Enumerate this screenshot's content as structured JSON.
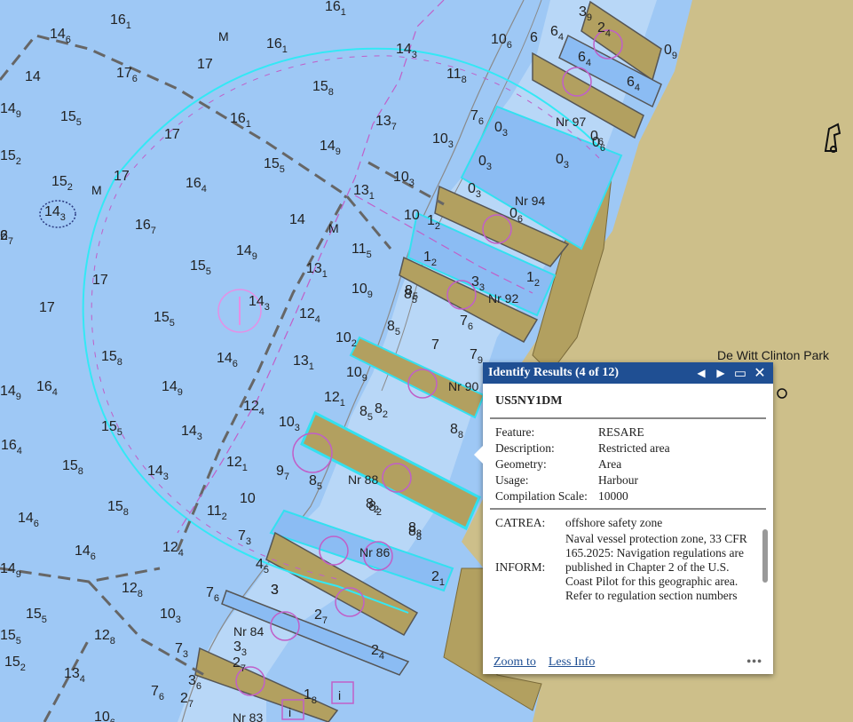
{
  "map": {
    "park_label": "De Witt Clinton Park",
    "pier_labels": [
      "Nr 97",
      "Nr 94",
      "Nr 92",
      "Nr 90",
      "Nr 88",
      "Nr 86",
      "Nr 84",
      "Nr 83"
    ],
    "mooring_symbol": "M",
    "info_symbol": "i",
    "soundings": [
      {
        "main": "14",
        "sub": "6"
      },
      {
        "main": "16",
        "sub": "1"
      },
      {
        "main": "16",
        "sub": "1"
      },
      {
        "main": "16",
        "sub": "1"
      },
      {
        "main": "14",
        "sub": "3"
      },
      {
        "main": "10",
        "sub": "6"
      },
      {
        "main": "14",
        "sub": ""
      },
      {
        "main": "17",
        "sub": "6"
      },
      {
        "main": "17",
        "sub": ""
      },
      {
        "main": "15",
        "sub": "8"
      },
      {
        "main": "11",
        "sub": "8"
      },
      {
        "main": "14",
        "sub": "9"
      },
      {
        "main": "15",
        "sub": "5"
      },
      {
        "main": "16",
        "sub": "1"
      },
      {
        "main": "13",
        "sub": "7"
      },
      {
        "main": "7",
        "sub": "6"
      },
      {
        "main": "17",
        "sub": ""
      },
      {
        "main": "15",
        "sub": "2"
      },
      {
        "main": "14",
        "sub": "9"
      },
      {
        "main": "10",
        "sub": "3"
      },
      {
        "main": "15",
        "sub": "5"
      },
      {
        "main": "17",
        "sub": ""
      },
      {
        "main": "15",
        "sub": "2"
      },
      {
        "main": "16",
        "sub": "4"
      },
      {
        "main": "10",
        "sub": "3"
      },
      {
        "main": "13",
        "sub": "1"
      },
      {
        "main": "14",
        "sub": "3"
      },
      {
        "main": "16",
        "sub": "7"
      },
      {
        "main": "14",
        "sub": ""
      },
      {
        "main": "10",
        "sub": ""
      },
      {
        "main": "14",
        "sub": "9"
      },
      {
        "main": "11",
        "sub": "5"
      },
      {
        "main": "17",
        "sub": ""
      },
      {
        "main": "15",
        "sub": "5"
      },
      {
        "main": "13",
        "sub": "1"
      },
      {
        "main": "8",
        "sub": "5"
      },
      {
        "main": "17",
        "sub": ""
      },
      {
        "main": "14",
        "sub": "3"
      },
      {
        "main": "10",
        "sub": "9"
      },
      {
        "main": "15",
        "sub": "5"
      },
      {
        "main": "12",
        "sub": "4"
      },
      {
        "main": "8",
        "sub": "5"
      },
      {
        "main": "15",
        "sub": "8"
      },
      {
        "main": "14",
        "sub": "6"
      },
      {
        "main": "13",
        "sub": "1"
      },
      {
        "main": "10",
        "sub": "2"
      },
      {
        "main": "7",
        "sub": ""
      },
      {
        "main": "16",
        "sub": "4"
      },
      {
        "main": "14",
        "sub": "9"
      },
      {
        "main": "12",
        "sub": "4"
      },
      {
        "main": "10",
        "sub": "9"
      },
      {
        "main": "12",
        "sub": "1"
      },
      {
        "main": "15",
        "sub": "5"
      },
      {
        "main": "14",
        "sub": "3"
      },
      {
        "main": "10",
        "sub": "3"
      },
      {
        "main": "8",
        "sub": "5"
      },
      {
        "main": "16",
        "sub": "4"
      },
      {
        "main": "14",
        "sub": "3"
      },
      {
        "main": "12",
        "sub": "1"
      },
      {
        "main": "9",
        "sub": "7"
      },
      {
        "main": "8",
        "sub": "5"
      },
      {
        "main": "15",
        "sub": "8"
      },
      {
        "main": "14",
        "sub": "6"
      },
      {
        "main": "11",
        "sub": "2"
      },
      {
        "main": "10",
        "sub": ""
      },
      {
        "main": "8",
        "sub": "2"
      },
      {
        "main": "15",
        "sub": "8"
      },
      {
        "main": "14",
        "sub": "6"
      },
      {
        "main": "12",
        "sub": "4"
      },
      {
        "main": "7",
        "sub": "3"
      },
      {
        "main": "8",
        "sub": "8"
      },
      {
        "main": "14",
        "sub": "9"
      },
      {
        "main": "12",
        "sub": "8"
      },
      {
        "main": "4",
        "sub": "5"
      },
      {
        "main": "15",
        "sub": "5"
      },
      {
        "main": "10",
        "sub": "3"
      },
      {
        "main": "7",
        "sub": "6"
      },
      {
        "main": "12",
        "sub": "8"
      },
      {
        "main": "7",
        "sub": "3"
      },
      {
        "main": "15",
        "sub": "2"
      },
      {
        "main": "13",
        "sub": "4"
      },
      {
        "main": "7",
        "sub": "6"
      },
      {
        "main": "2",
        "sub": "7"
      },
      {
        "main": "3",
        "sub": "6"
      },
      {
        "main": "3",
        "sub": "9"
      },
      {
        "main": "6",
        "sub": "4"
      },
      {
        "main": "6",
        "sub": "4"
      },
      {
        "main": "6",
        "sub": "4"
      },
      {
        "main": "0",
        "sub": "9"
      },
      {
        "main": "2",
        "sub": "4"
      },
      {
        "main": "0",
        "sub": "3"
      },
      {
        "main": "0",
        "sub": "3"
      },
      {
        "main": "0",
        "sub": "3"
      },
      {
        "main": "0",
        "sub": "3"
      },
      {
        "main": "0",
        "sub": "6"
      },
      {
        "main": "0",
        "sub": "6"
      },
      {
        "main": "1",
        "sub": "2"
      },
      {
        "main": "1",
        "sub": "2"
      },
      {
        "main": "3",
        "sub": "3"
      },
      {
        "main": "1",
        "sub": "2"
      },
      {
        "main": "7",
        "sub": "6"
      },
      {
        "main": "8",
        "sub": "5"
      },
      {
        "main": "8",
        "sub": "2"
      },
      {
        "main": "8",
        "sub": "8"
      },
      {
        "main": "8",
        "sub": "2"
      },
      {
        "main": "8",
        "sub": "8"
      },
      {
        "main": "2",
        "sub": "1"
      },
      {
        "main": "3",
        "sub": ""
      },
      {
        "main": "2",
        "sub": "7"
      },
      {
        "main": "2",
        "sub": "4"
      },
      {
        "main": "3",
        "sub": "3"
      },
      {
        "main": "2",
        "sub": "7"
      },
      {
        "main": "1",
        "sub": "8"
      },
      {
        "main": "6",
        "sub": ""
      },
      {
        "main": "2",
        "sub": "7"
      },
      {
        "main": "0",
        "sub": "6"
      },
      {
        "main": "3",
        "sub": ""
      },
      {
        "main": "7",
        "sub": "9"
      },
      {
        "main": "10",
        "sub": "6"
      },
      {
        "main": "6",
        "sub": ""
      },
      {
        "main": "2",
        "sub": "7"
      },
      {
        "main": "15",
        "sub": "5"
      },
      {
        "main": "14",
        "sub": "9"
      }
    ]
  },
  "popup": {
    "title": "Identify Results (4 of 12)",
    "prev_icon": "triangle-left-icon",
    "next_icon": "triangle-right-icon",
    "maximize_icon": "maximize-icon",
    "close_icon": "close-icon",
    "feature_name": "US5NY1DM",
    "attributes": [
      {
        "key": "Feature:",
        "value": "RESARE"
      },
      {
        "key": "Description:",
        "value": "Restricted area"
      },
      {
        "key": "Geometry:",
        "value": "Area"
      },
      {
        "key": "Usage:",
        "value": "Harbour"
      },
      {
        "key": "Compilation Scale:",
        "value": "10000"
      }
    ],
    "extra": [
      {
        "key": "CATREA:",
        "value": "offshore safety zone"
      },
      {
        "key": "INFORM:",
        "value": "Naval vessel protection zone, 33 CFR 165.2025: Navigation regulations are published in Chapter 2 of the U.S. Coast Pilot for this geographic area. Refer to regulation section numbers"
      }
    ],
    "zoom_label": "Zoom to",
    "less_label": "Less Info",
    "more_label": "•••"
  }
}
